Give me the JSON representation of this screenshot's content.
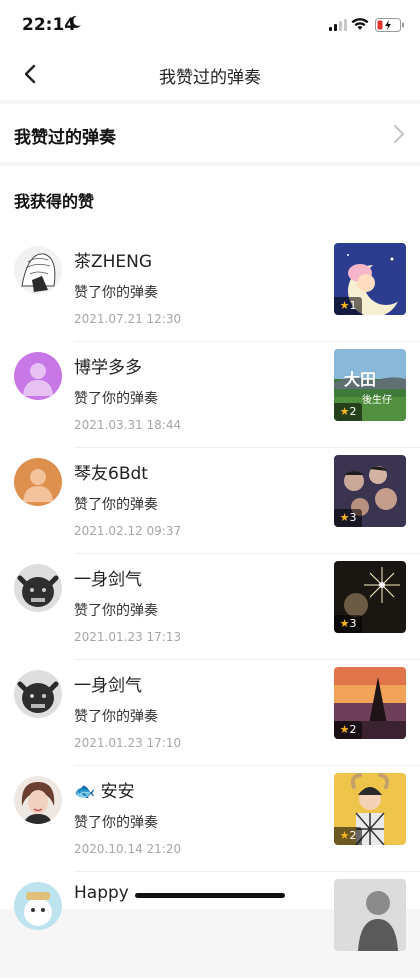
{
  "status_bar": {
    "time": "22:14"
  },
  "nav": {
    "title": "我赞过的弹奏"
  },
  "liked_row": {
    "label": "我赞过的弹奏"
  },
  "section": {
    "title": "我获得的赞"
  },
  "items": [
    {
      "name": "茶ZHENG",
      "action": "赞了你的弹奏",
      "date": "2021.07.21 12:30",
      "stars": "1"
    },
    {
      "name": "博学多多",
      "action": "赞了你的弹奏",
      "date": "2021.03.31 18:44",
      "stars": "2"
    },
    {
      "name": "琴友6Bdt",
      "action": "赞了你的弹奏",
      "date": "2021.02.12 09:37",
      "stars": "3"
    },
    {
      "name": "一身剑气",
      "action": "赞了你的弹奏",
      "date": "2021.01.23 17:13",
      "stars": "3"
    },
    {
      "name": "一身剑气",
      "action": "赞了你的弹奏",
      "date": "2021.01.23 17:10",
      "stars": "2"
    },
    {
      "name": "🐟 安安",
      "action": "赞了你的弹奏",
      "date": "2020.10.14 21:20",
      "stars": "2"
    },
    {
      "name": "Happy",
      "action": "",
      "date": "",
      "stars": ""
    }
  ]
}
